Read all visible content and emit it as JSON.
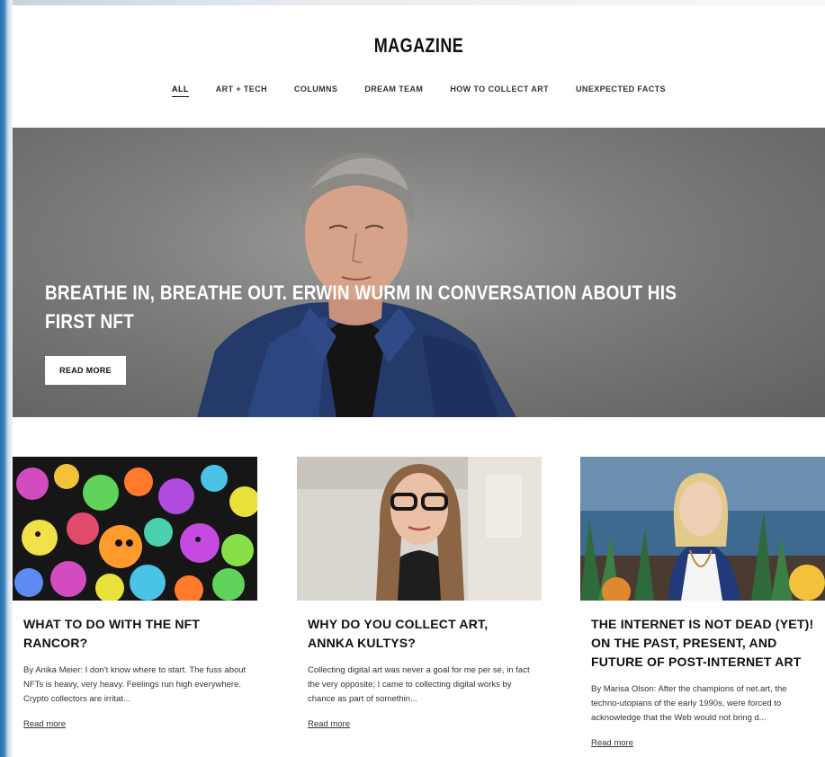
{
  "header": {
    "title": "MAGAZINE",
    "nav": [
      {
        "label": "ALL",
        "active": true
      },
      {
        "label": "ART + TECH",
        "active": false
      },
      {
        "label": "COLUMNS",
        "active": false
      },
      {
        "label": "DREAM TEAM",
        "active": false
      },
      {
        "label": "HOW TO COLLECT ART",
        "active": false
      },
      {
        "label": "UNEXPECTED FACTS",
        "active": false
      }
    ]
  },
  "hero": {
    "title": "BREATHE IN, BREATHE OUT. ERWIN WURM IN CONVERSATION ABOUT HIS FIRST NFT",
    "button_label": "READ MORE"
  },
  "articles": [
    {
      "title": "WHAT TO DO WITH THE NFT RANCOR?",
      "excerpt": "By Anika Meier: I don't know where to start. The fuss about NFTs is heavy, very heavy. Feelings run high everywhere. Crypto collectors are irritat...",
      "link_label": "Read more"
    },
    {
      "title": "WHY DO YOU COLLECT ART, ANNKA KULTYS?",
      "excerpt": "Collecting digital art was never a goal for me per se, in fact the very opposite; I came to collecting digital works by chance as part of somethin...",
      "link_label": "Read more"
    },
    {
      "title": "THE INTERNET IS NOT DEAD (YET)! ON THE PAST, PRESENT, AND FUTURE OF POST-INTERNET ART",
      "excerpt": "By Marisa Olson: After the champions of net.art, the techno-utopians of the early 1990s, were forced to acknowledge that the Web would not bring d...",
      "link_label": "Read more"
    }
  ]
}
